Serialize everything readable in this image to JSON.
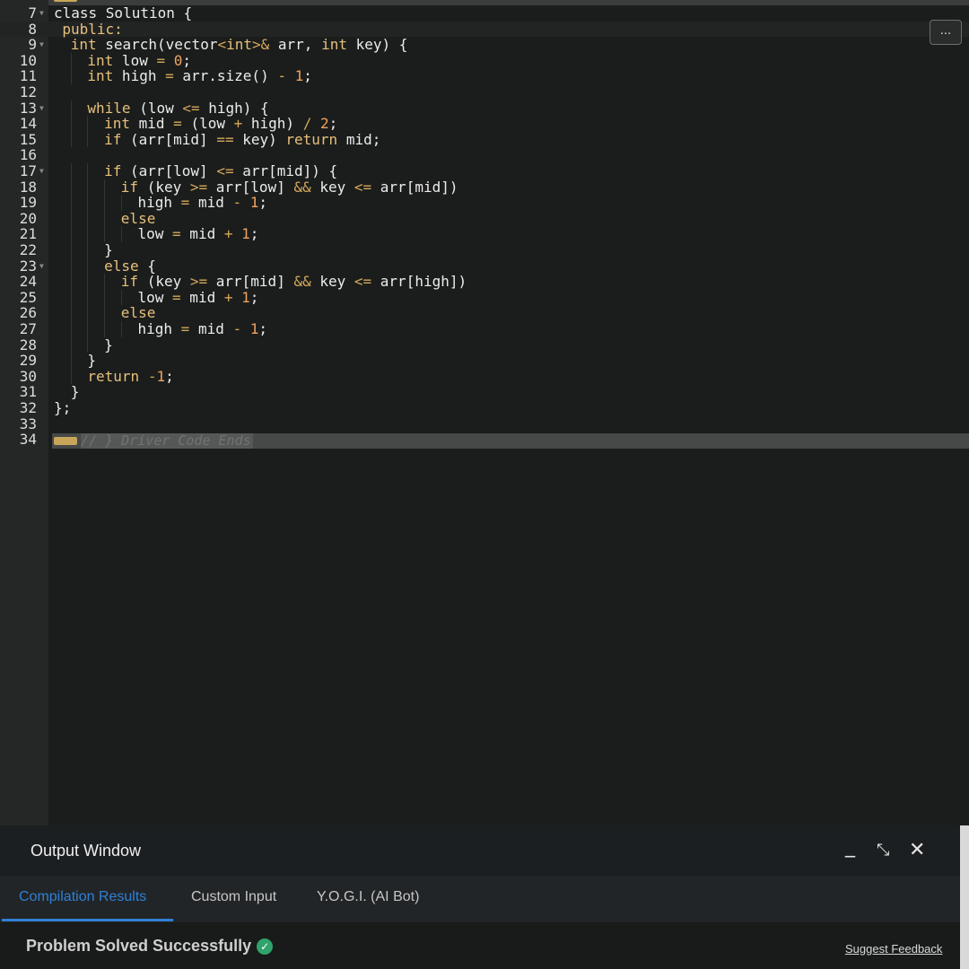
{
  "editor": {
    "fold_bottom_text": "// } Driver Code Ends",
    "more_button_label": "...",
    "lines": [
      {
        "num": "7",
        "fold": true,
        "indent": 0,
        "tokens": [
          {
            "c": "t",
            "v": "class Solution {"
          }
        ]
      },
      {
        "num": "8",
        "fold": false,
        "indent": 1,
        "tokens": [
          {
            "c": "k",
            "v": "public:"
          }
        ]
      },
      {
        "num": "9",
        "fold": true,
        "indent": 2,
        "tokens": [
          {
            "c": "k",
            "v": "int"
          },
          {
            "c": "t",
            "v": " search(vector"
          },
          {
            "c": "o",
            "v": "<"
          },
          {
            "c": "k",
            "v": "int"
          },
          {
            "c": "o",
            "v": ">&"
          },
          {
            "c": "t",
            "v": " arr, "
          },
          {
            "c": "k",
            "v": "int"
          },
          {
            "c": "t",
            "v": " key) {"
          }
        ]
      },
      {
        "num": "10",
        "fold": false,
        "indent": 4,
        "tokens": [
          {
            "c": "k",
            "v": "int"
          },
          {
            "c": "t",
            "v": " low "
          },
          {
            "c": "o",
            "v": "="
          },
          {
            "c": "t",
            "v": " "
          },
          {
            "c": "n",
            "v": "0"
          },
          {
            "c": "t",
            "v": ";"
          }
        ]
      },
      {
        "num": "11",
        "fold": false,
        "indent": 4,
        "tokens": [
          {
            "c": "k",
            "v": "int"
          },
          {
            "c": "t",
            "v": " high "
          },
          {
            "c": "o",
            "v": "="
          },
          {
            "c": "t",
            "v": " arr.size() "
          },
          {
            "c": "o",
            "v": "-"
          },
          {
            "c": "t",
            "v": " "
          },
          {
            "c": "n",
            "v": "1"
          },
          {
            "c": "t",
            "v": ";"
          }
        ]
      },
      {
        "num": "12",
        "fold": false,
        "indent": 0,
        "tokens": []
      },
      {
        "num": "13",
        "fold": true,
        "indent": 4,
        "tokens": [
          {
            "c": "k",
            "v": "while"
          },
          {
            "c": "t",
            "v": " (low "
          },
          {
            "c": "o",
            "v": "<="
          },
          {
            "c": "t",
            "v": " high) {"
          }
        ]
      },
      {
        "num": "14",
        "fold": false,
        "indent": 6,
        "tokens": [
          {
            "c": "k",
            "v": "int"
          },
          {
            "c": "t",
            "v": " mid "
          },
          {
            "c": "o",
            "v": "="
          },
          {
            "c": "t",
            "v": " (low "
          },
          {
            "c": "o",
            "v": "+"
          },
          {
            "c": "t",
            "v": " high) "
          },
          {
            "c": "o",
            "v": "/"
          },
          {
            "c": "t",
            "v": " "
          },
          {
            "c": "n",
            "v": "2"
          },
          {
            "c": "t",
            "v": ";"
          }
        ]
      },
      {
        "num": "15",
        "fold": false,
        "indent": 6,
        "tokens": [
          {
            "c": "k",
            "v": "if"
          },
          {
            "c": "t",
            "v": " (arr[mid] "
          },
          {
            "c": "o",
            "v": "=="
          },
          {
            "c": "t",
            "v": " key) "
          },
          {
            "c": "k",
            "v": "return"
          },
          {
            "c": "t",
            "v": " mid;"
          }
        ]
      },
      {
        "num": "16",
        "fold": false,
        "indent": 0,
        "tokens": []
      },
      {
        "num": "17",
        "fold": true,
        "indent": 6,
        "tokens": [
          {
            "c": "k",
            "v": "if"
          },
          {
            "c": "t",
            "v": " (arr[low] "
          },
          {
            "c": "o",
            "v": "<="
          },
          {
            "c": "t",
            "v": " arr[mid]) {"
          }
        ]
      },
      {
        "num": "18",
        "fold": false,
        "indent": 8,
        "tokens": [
          {
            "c": "k",
            "v": "if"
          },
          {
            "c": "t",
            "v": " (key "
          },
          {
            "c": "o",
            "v": ">="
          },
          {
            "c": "t",
            "v": " arr[low] "
          },
          {
            "c": "o",
            "v": "&&"
          },
          {
            "c": "t",
            "v": " key "
          },
          {
            "c": "o",
            "v": "<="
          },
          {
            "c": "t",
            "v": " arr[mid])"
          }
        ]
      },
      {
        "num": "19",
        "fold": false,
        "indent": 10,
        "tokens": [
          {
            "c": "t",
            "v": "high "
          },
          {
            "c": "o",
            "v": "="
          },
          {
            "c": "t",
            "v": " mid "
          },
          {
            "c": "o",
            "v": "-"
          },
          {
            "c": "t",
            "v": " "
          },
          {
            "c": "n",
            "v": "1"
          },
          {
            "c": "t",
            "v": ";"
          }
        ]
      },
      {
        "num": "20",
        "fold": false,
        "indent": 8,
        "tokens": [
          {
            "c": "k",
            "v": "else"
          }
        ]
      },
      {
        "num": "21",
        "fold": false,
        "indent": 10,
        "tokens": [
          {
            "c": "t",
            "v": "low "
          },
          {
            "c": "o",
            "v": "="
          },
          {
            "c": "t",
            "v": " mid "
          },
          {
            "c": "o",
            "v": "+"
          },
          {
            "c": "t",
            "v": " "
          },
          {
            "c": "n",
            "v": "1"
          },
          {
            "c": "t",
            "v": ";"
          }
        ]
      },
      {
        "num": "22",
        "fold": false,
        "indent": 6,
        "tokens": [
          {
            "c": "t",
            "v": "}"
          }
        ]
      },
      {
        "num": "23",
        "fold": true,
        "indent": 6,
        "tokens": [
          {
            "c": "k",
            "v": "else"
          },
          {
            "c": "t",
            "v": " {"
          }
        ]
      },
      {
        "num": "24",
        "fold": false,
        "indent": 8,
        "tokens": [
          {
            "c": "k",
            "v": "if"
          },
          {
            "c": "t",
            "v": " (key "
          },
          {
            "c": "o",
            "v": ">="
          },
          {
            "c": "t",
            "v": " arr[mid] "
          },
          {
            "c": "o",
            "v": "&&"
          },
          {
            "c": "t",
            "v": " key "
          },
          {
            "c": "o",
            "v": "<="
          },
          {
            "c": "t",
            "v": " arr[high])"
          }
        ]
      },
      {
        "num": "25",
        "fold": false,
        "indent": 10,
        "tokens": [
          {
            "c": "t",
            "v": "low "
          },
          {
            "c": "o",
            "v": "="
          },
          {
            "c": "t",
            "v": " mid "
          },
          {
            "c": "o",
            "v": "+"
          },
          {
            "c": "t",
            "v": " "
          },
          {
            "c": "n",
            "v": "1"
          },
          {
            "c": "t",
            "v": ";"
          }
        ]
      },
      {
        "num": "26",
        "fold": false,
        "indent": 8,
        "tokens": [
          {
            "c": "k",
            "v": "else"
          }
        ]
      },
      {
        "num": "27",
        "fold": false,
        "indent": 10,
        "tokens": [
          {
            "c": "t",
            "v": "high "
          },
          {
            "c": "o",
            "v": "="
          },
          {
            "c": "t",
            "v": " mid "
          },
          {
            "c": "o",
            "v": "-"
          },
          {
            "c": "t",
            "v": " "
          },
          {
            "c": "n",
            "v": "1"
          },
          {
            "c": "t",
            "v": ";"
          }
        ]
      },
      {
        "num": "28",
        "fold": false,
        "indent": 6,
        "tokens": [
          {
            "c": "t",
            "v": "}"
          }
        ]
      },
      {
        "num": "29",
        "fold": false,
        "indent": 4,
        "tokens": [
          {
            "c": "t",
            "v": "}"
          }
        ]
      },
      {
        "num": "30",
        "fold": false,
        "indent": 4,
        "tokens": [
          {
            "c": "k",
            "v": "return"
          },
          {
            "c": "t",
            "v": " "
          },
          {
            "c": "o",
            "v": "-"
          },
          {
            "c": "n",
            "v": "1"
          },
          {
            "c": "t",
            "v": ";"
          }
        ]
      },
      {
        "num": "31",
        "fold": false,
        "indent": 2,
        "tokens": [
          {
            "c": "t",
            "v": "}"
          }
        ]
      },
      {
        "num": "32",
        "fold": false,
        "indent": 0,
        "tokens": [
          {
            "c": "t",
            "v": "};"
          }
        ]
      },
      {
        "num": "33",
        "fold": false,
        "indent": 0,
        "tokens": []
      },
      {
        "num": "34",
        "fold": false,
        "indent": 0,
        "tokens": []
      }
    ],
    "active_line": "8"
  },
  "output_window": {
    "title": "Output Window",
    "minimize_icon": "minimize-icon",
    "expand_icon": "expand-icon",
    "close_icon": "close-icon",
    "tabs": [
      {
        "label": "Compilation Results",
        "active": true
      },
      {
        "label": "Custom Input",
        "active": false
      },
      {
        "label": "Y.O.G.I. (AI Bot)",
        "active": false
      }
    ],
    "status_text": "Problem Solved Successfully",
    "status_icon": "check-circle-icon",
    "feedback_link": "Suggest Feedback",
    "colors": {
      "accent": "#2f80d6",
      "success": "#2fa36b"
    }
  }
}
